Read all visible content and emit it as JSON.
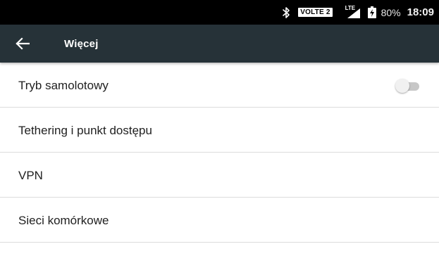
{
  "status_bar": {
    "bluetooth_icon": "bluetooth-icon",
    "volte_label": "VOLTE 2",
    "lte_label": "LTE",
    "signal_icon": "signal-icon",
    "battery_icon": "battery-charging-icon",
    "battery_percent": "80%",
    "time": "18:09"
  },
  "toolbar": {
    "back_icon": "arrow-back-icon",
    "title": "Więcej",
    "background_color": "#263238"
  },
  "settings": {
    "items": [
      {
        "label": "Tryb samolotowy",
        "has_toggle": true,
        "toggle_on": false
      },
      {
        "label": "Tethering i punkt dostępu"
      },
      {
        "label": "VPN"
      },
      {
        "label": "Sieci komórkowe"
      }
    ]
  }
}
